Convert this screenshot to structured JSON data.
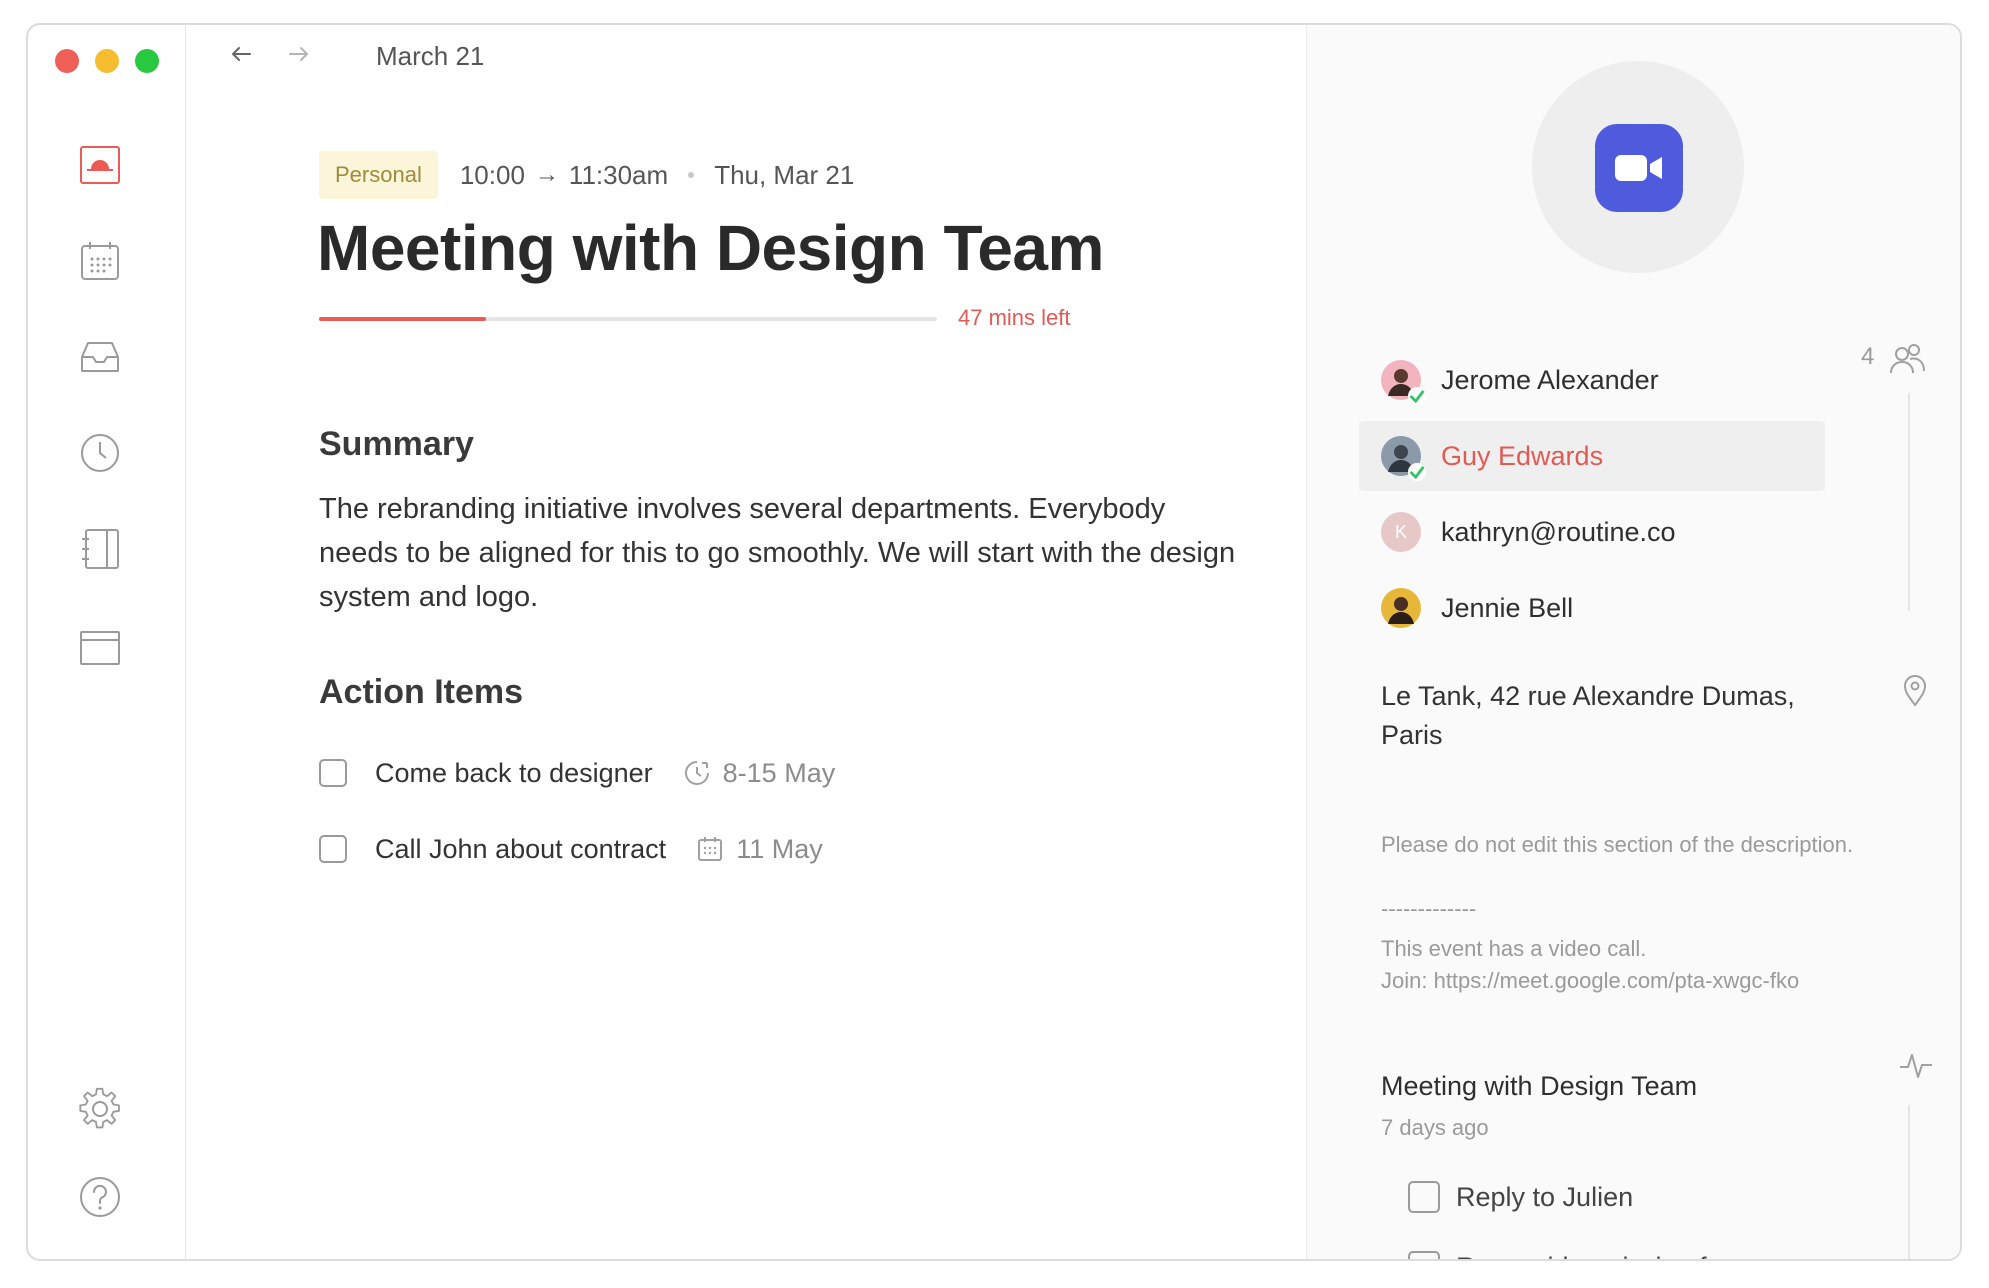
{
  "window": {
    "traffic_colors": [
      "#ee5f58",
      "#f5bd2f",
      "#28c840"
    ]
  },
  "sidebar": {
    "items": [
      {
        "icon": "today-icon"
      },
      {
        "icon": "calendar-icon"
      },
      {
        "icon": "inbox-icon"
      },
      {
        "icon": "clock-icon"
      },
      {
        "icon": "notebook-icon"
      },
      {
        "icon": "folder-icon"
      }
    ],
    "bottom": [
      {
        "icon": "gear-icon"
      },
      {
        "icon": "help-icon"
      }
    ]
  },
  "topbar": {
    "date": "March 21"
  },
  "event": {
    "tag": "Personal",
    "start": "10:00",
    "end": "11:30am",
    "day": "Thu, Mar 21",
    "title": "Meeting with Design Team",
    "progress_fraction": 0.27,
    "mins_left": "47 mins left",
    "accent_color": "#ec5a55"
  },
  "summary": {
    "heading": "Summary",
    "text": "The rebranding initiative involves several departments. Everybody needs to be aligned for this to go smoothly. We will start with the design system and logo."
  },
  "action_items": {
    "heading": "Action Items",
    "items": [
      {
        "text": "Come back to designer",
        "icon": "clock-icon",
        "date": "8-15 May",
        "checked": false
      },
      {
        "text": "Call John about contract",
        "icon": "calendar-icon",
        "date": "11 May",
        "checked": false
      }
    ]
  },
  "right_panel": {
    "video_color": "#4e5bdc",
    "attendee_count": "4",
    "attendees": [
      {
        "name": "Jerome Alexander",
        "accepted": true,
        "selected": false
      },
      {
        "name": "Guy Edwards",
        "accepted": true,
        "selected": true
      },
      {
        "name": "kathryn@routine.co",
        "initial": "K",
        "accepted": false,
        "selected": false
      },
      {
        "name": "Jennie Bell",
        "accepted": false,
        "selected": false
      }
    ],
    "location": "Le Tank, 42 rue Alexandre Dumas, Paris",
    "description": {
      "line1": "Please do not edit this section of the description.",
      "divider": "-------------",
      "line2": "This event has a video call.",
      "line3": "Join: https://meet.google.com/pta-xwgc-fko"
    },
    "history": {
      "title": "Meeting with Design Team",
      "time": "7 days ago",
      "items": [
        {
          "text": "Reply to Julien"
        },
        {
          "text": "Reconsider missing fea"
        }
      ]
    }
  }
}
